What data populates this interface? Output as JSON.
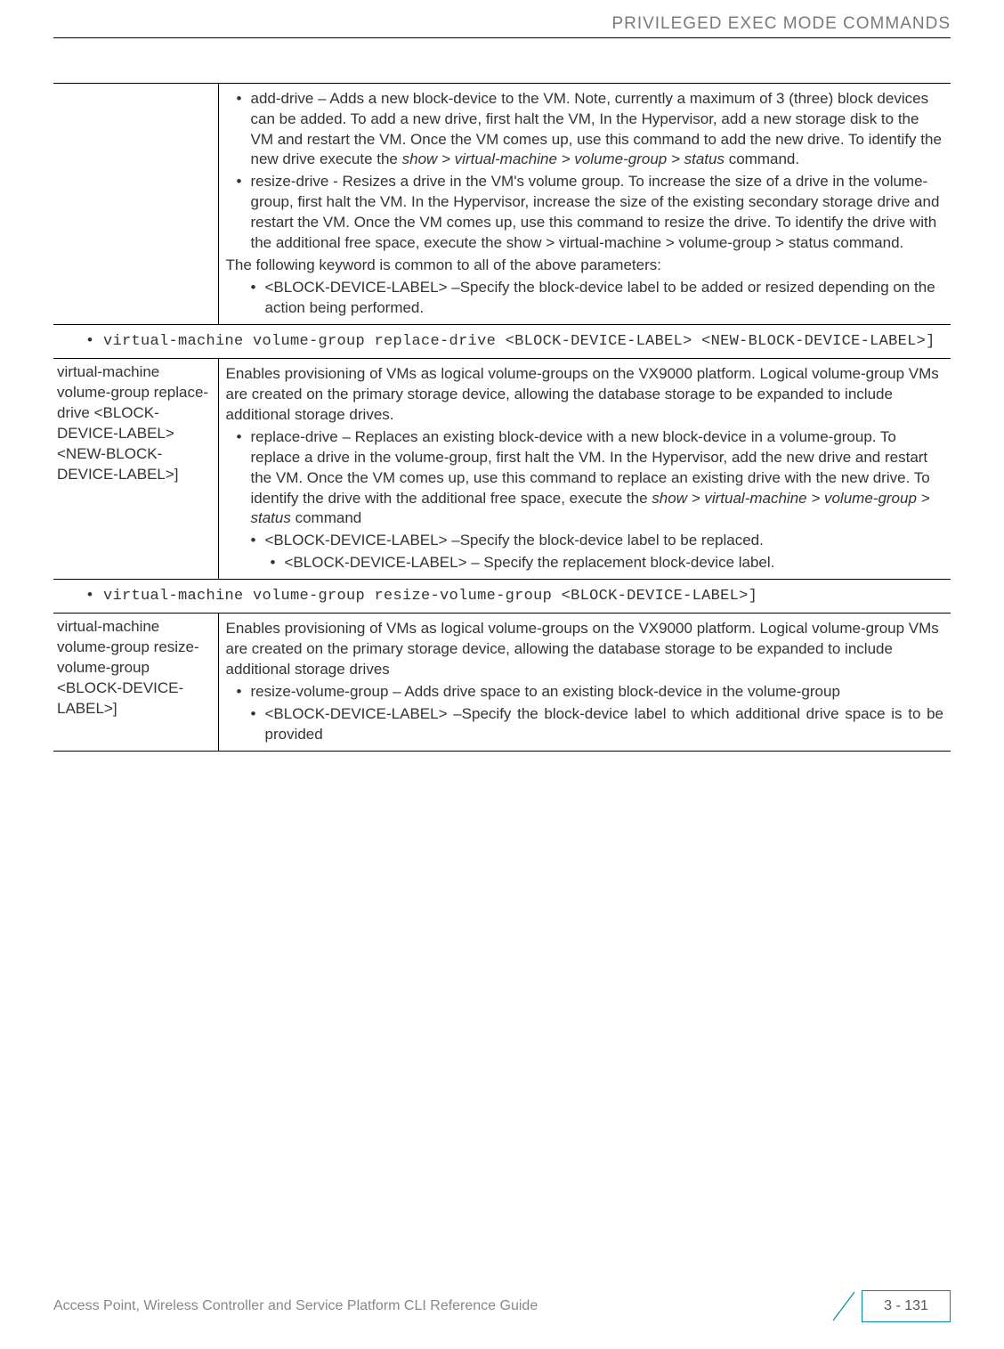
{
  "header": {
    "title": "PRIVILEGED EXEC MODE COMMANDS"
  },
  "row1": {
    "add_drive": "add-drive – Adds a new block-device to the VM. Note, currently a maximum of 3 (three) block devices can be added. To add a new drive, first halt the VM, In the Hypervisor, add a new storage disk to the VM and restart the VM. Once the VM comes up, use this command to add the new drive. To identify the new drive execute the ",
    "add_drive_cmd": "show > virtual-machine > volume-group > status",
    "add_drive_tail": " command.",
    "resize_drive": "resize-drive - Resizes a drive in the VM's volume group. To increase the size of a drive in the volume-group, first halt the VM. In the Hypervisor, increase the size of the existing secondary storage drive and restart the VM. Once the VM comes up, use this command to resize the drive. To identify the drive with the additional free space, execute the show > virtual-machine > volume-group > status command.",
    "common": "The following keyword is common to all of the above parameters:",
    "block_label": "<BLOCK-DEVICE-LABEL> –Specify the block-device label to be added or resized depending on the action being performed."
  },
  "code1": "virtual-machine volume-group replace-drive <BLOCK-DEVICE-LABEL> <NEW-BLOCK-DEVICE-LABEL>]",
  "row2": {
    "left": "virtual-machine volume-group replace-drive <BLOCK-DEVICE-LABEL> <NEW-BLOCK-DEVICE-LABEL>]",
    "intro": "Enables provisioning of VMs as logical volume-groups on the VX9000 platform. Logical volume-group VMs are created on the primary storage device, allowing the database storage to be expanded to include additional storage drives.",
    "replace1": "replace-drive – Replaces an existing block-device with a new block-device in a volume-group. To replace a drive in the volume-group, first halt the VM. In the Hypervisor, add the new drive and restart the VM. Once the VM comes up, use this command to replace an existing drive with the new drive. To identify the drive with the additional free space, execute the ",
    "replace_cmd": "show > virtual-machine > volume-group > status",
    "replace_tail": " command",
    "sub1": "<BLOCK-DEVICE-LABEL> –Specify the block-device label to be replaced.",
    "sub2": "<BLOCK-DEVICE-LABEL> – Specify the replacement block-device label."
  },
  "code2": "virtual-machine volume-group resize-volume-group <BLOCK-DEVICE-LABEL>]",
  "row3": {
    "left": "virtual-machine volume-group resize-volume-group <BLOCK-DEVICE-LABEL>]",
    "intro": "Enables provisioning of VMs as logical volume-groups on the VX9000 platform. Logical volume-group VMs are created on the primary storage device, allowing the database storage to be expanded to include additional storage drives",
    "resize": "resize-volume-group – Adds drive space to an existing block-device in the volume-group",
    "sub": "<BLOCK-DEVICE-LABEL> –Specify the block-device label to which additional drive space is to be provided"
  },
  "footer": {
    "left": "Access Point, Wireless Controller and Service Platform CLI Reference Guide",
    "page": "3 - 131"
  }
}
